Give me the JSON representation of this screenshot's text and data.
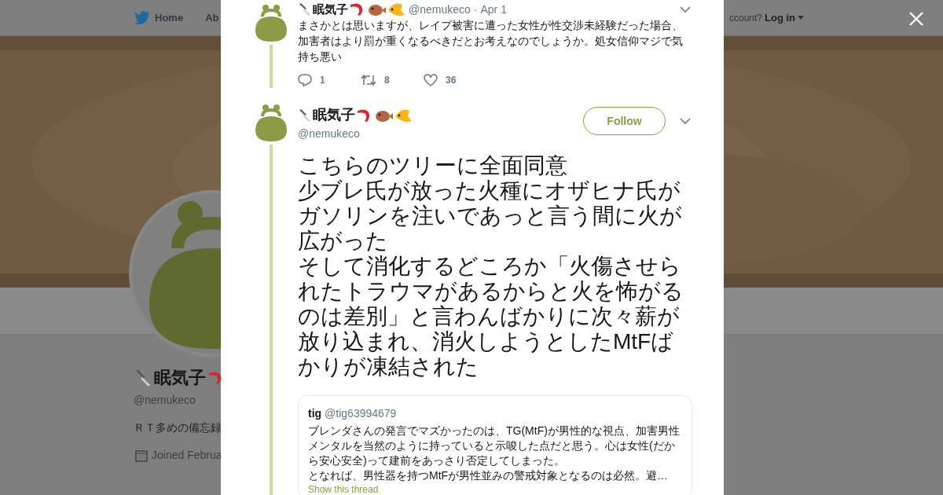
{
  "nav": {
    "items": [
      {
        "label": "Home",
        "kind": "bird"
      },
      {
        "label": "Ab",
        "kind": "plain"
      }
    ],
    "account_prompt": "ccount?",
    "login": "Log in"
  },
  "profile": {
    "name": "眠気子",
    "handle": "@nemukeco",
    "bio": "ＲＴ多めの備忘録",
    "joined": "Joined Februa"
  },
  "thread": [
    {
      "kind": "reply",
      "name": "眠気子",
      "handle": "@nemukeco",
      "separator": "·",
      "time": "Apr 1",
      "text": [
        "まさかとは思いますが、レイプ被害に遭った女性が性交渉未経験だった場合、加害者はより罰が重くなるべきだとお考えなのでしょうか。処女信仰マジで気持ち悪い"
      ],
      "replies": "1",
      "retweets": "8",
      "likes": "36"
    },
    {
      "kind": "focused",
      "name": "眠気子",
      "handle": "@nemukeco",
      "follow": "Follow",
      "text": [
        "こちらのツリーに全面同意",
        "少ブレ氏が放った火種にオザヒナ氏がガソリンを注いであっと言う間に火が広がった",
        "そして消化するどころか「火傷させられたトラウマがあるからと火を怖がるのは差別」と言わんばかりに次々薪が放り込まれ、消火しようとしたMtFばかりが凍結された"
      ],
      "quote": {
        "name": "tig",
        "handle": "@tig63994679",
        "text": [
          "ブレンダさんの発言でマズかったのは、TG(MtF)が男性的な視点、加害男性メンタルを当然のように持っていると示唆した点だと思う。心は女性(だから安心安全)って建前をあっさり否定してしまった。",
          "となれば、男性器を持つMtFが男性並みの警戒対象となるのは必然。避…"
        ],
        "link": "Show this thread"
      }
    }
  ]
}
